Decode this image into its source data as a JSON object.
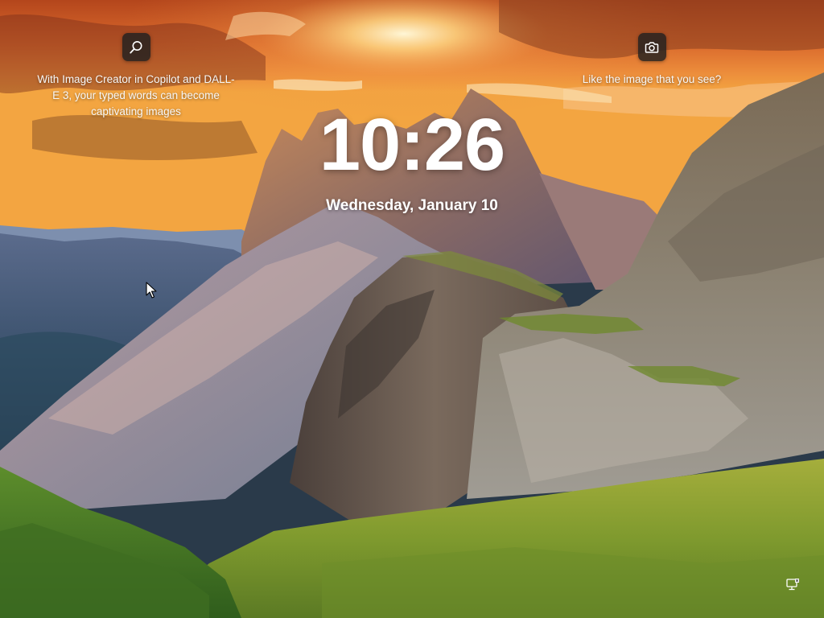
{
  "lock_screen": {
    "time": "10:26",
    "date": "Wednesday, January 10"
  },
  "spotlight": {
    "left_widget": {
      "icon": "search-icon",
      "text": "With Image Creator in Copilot and DALL-E 3, your typed words can become captivating images"
    },
    "right_widget": {
      "icon": "camera-icon",
      "text": "Like the image that you see?"
    }
  },
  "tray": {
    "network_icon": "network-icon"
  },
  "colors": {
    "sky_top": "#b8531e",
    "sun": "#ffe9a0",
    "grass": "#8da433",
    "rock": "#5a4c44",
    "widget_bg": "#202020",
    "text": "#ffffff"
  }
}
